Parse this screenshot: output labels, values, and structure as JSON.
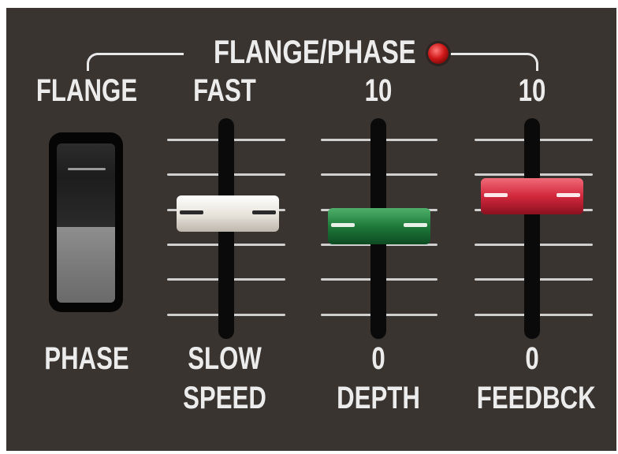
{
  "group": {
    "title": "FLANGE/PHASE",
    "led_color": "#d01818"
  },
  "mode_switch": {
    "top_label": "FLANGE",
    "bottom_label": "PHASE",
    "state": "PHASE"
  },
  "speed": {
    "top_label": "FAST",
    "min_label": "SLOW",
    "name": "SPEED",
    "level": 0.5,
    "cap_color": "#e8e4dc"
  },
  "depth": {
    "top_label": "10",
    "min_label": "0",
    "name": "DEPTH",
    "level": 0.42,
    "cap_color": "#1e7a3a"
  },
  "feedback": {
    "top_label": "10",
    "min_label": "0",
    "name": "FEEDBCK",
    "level": 0.61,
    "cap_color": "#d2283c"
  }
}
